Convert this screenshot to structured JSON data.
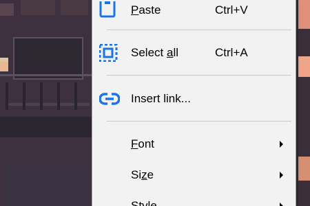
{
  "menu": {
    "items": [
      {
        "label": "Paste",
        "mnemonic": "P",
        "shortcut": "Ctrl+V",
        "icon": "paste-icon"
      },
      {
        "label": "Select all",
        "mnemonic": "a",
        "shortcut": "Ctrl+A",
        "icon": "select-all-icon"
      },
      {
        "label": "Insert link...",
        "mnemonic": "",
        "shortcut": "",
        "icon": "link-icon"
      },
      {
        "label": "Font",
        "mnemonic": "F",
        "shortcut": "",
        "icon": "",
        "submenu": true
      },
      {
        "label": "Size",
        "mnemonic": "z",
        "shortcut": "",
        "icon": "",
        "submenu": true
      },
      {
        "label": "Style",
        "mnemonic": "",
        "shortcut": "",
        "icon": "",
        "submenu": true
      }
    ]
  },
  "colors": {
    "icon_blue": "#1a73e8",
    "menu_bg": "#f2f2f2",
    "separator": "#c8c8c8"
  }
}
